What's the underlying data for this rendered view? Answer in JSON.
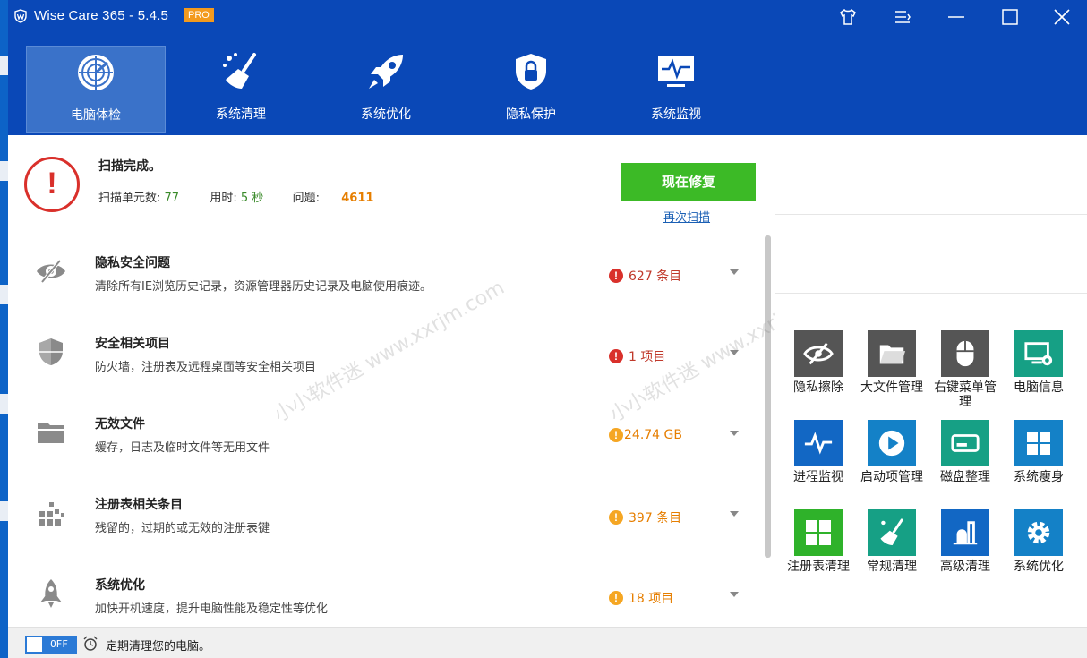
{
  "window": {
    "title": "Wise Care 365 - 5.4.5",
    "badge": "PRO",
    "controls": [
      "skin-icon",
      "menu-icon",
      "minimize-icon",
      "maximize-icon",
      "close-icon"
    ]
  },
  "nav": {
    "tabs": [
      {
        "label": "电脑体检",
        "icon": "radar-icon",
        "active": true
      },
      {
        "label": "系统清理",
        "icon": "broom-icon",
        "active": false
      },
      {
        "label": "系统优化",
        "icon": "rocket-icon",
        "active": false
      },
      {
        "label": "隐私保护",
        "icon": "shield-lock-icon",
        "active": false
      },
      {
        "label": "系统监视",
        "icon": "monitor-pulse-icon",
        "active": false
      }
    ]
  },
  "scan": {
    "status": "扫描完成。",
    "units_label": "扫描单元数:",
    "units_value": "77",
    "time_label": "用时:",
    "time_value": "5 秒",
    "issues_label": "问题:",
    "issues_value": "4611",
    "fix_button": "现在修复",
    "rescan_link": "再次扫描"
  },
  "items": [
    {
      "title": "隐私安全问题",
      "desc": "清除所有IE浏览历史记录，资源管理器历史记录及电脑使用痕迹。",
      "count": "627 条目",
      "severity": "red",
      "icon": "eye-hidden-icon"
    },
    {
      "title": "安全相关项目",
      "desc": "防火墙，注册表及远程桌面等安全相关项目",
      "count": "1 项目",
      "severity": "red",
      "icon": "shield-icon"
    },
    {
      "title": "无效文件",
      "desc": "缓存，日志及临时文件等无用文件",
      "count": "24.74 GB",
      "severity": "orange",
      "icon": "folder-icon"
    },
    {
      "title": "注册表相关条目",
      "desc": "残留的，过期的或无效的注册表键",
      "count": "397 条目",
      "severity": "orange",
      "icon": "registry-blocks-icon"
    },
    {
      "title": "系统优化",
      "desc": "加快开机速度，提升电脑性能及稳定性等优化",
      "count": "18 项目",
      "severity": "orange",
      "icon": "rocket-icon"
    }
  ],
  "tools": [
    {
      "label": "隐私擦除",
      "icon": "eye-hidden-icon",
      "color": "#555555"
    },
    {
      "label": "大文件管理",
      "icon": "folder-icon",
      "color": "#555555"
    },
    {
      "label": "右键菜单管理",
      "icon": "mouse-icon",
      "color": "#555555"
    },
    {
      "label": "电脑信息",
      "icon": "pc-gear-icon",
      "color": "#16a085"
    },
    {
      "label": "进程监视",
      "icon": "pulse-icon",
      "color": "#1267c4"
    },
    {
      "label": "启动项管理",
      "icon": "play-icon",
      "color": "#1481c7"
    },
    {
      "label": "磁盘整理",
      "icon": "disk-icon",
      "color": "#16a085"
    },
    {
      "label": "系统瘦身",
      "icon": "windows-icon",
      "color": "#1481c7"
    },
    {
      "label": "注册表清理",
      "icon": "grid-icon",
      "color": "#2fb22a"
    },
    {
      "label": "常规清理",
      "icon": "broom-icon",
      "color": "#16a085"
    },
    {
      "label": "高级清理",
      "icon": "advanced-clean-icon",
      "color": "#1267c4"
    },
    {
      "label": "系统优化",
      "icon": "gear-icon",
      "color": "#1481c7"
    }
  ],
  "bottom": {
    "toggle_state": "OFF",
    "schedule_text": "定期清理您的电脑。"
  },
  "watermark": [
    "小小软件迷 www.xxrjm.com",
    "小小软件迷 www.xxrjm.com"
  ],
  "colors": {
    "header": "#0a48b7",
    "active_tab": "#3a72c9",
    "fix_button": "#3cba26",
    "issue_red": "#d9302b",
    "issue_orange": "#f5a623",
    "count_red": "#c0392b",
    "count_orange": "#e67e00"
  }
}
